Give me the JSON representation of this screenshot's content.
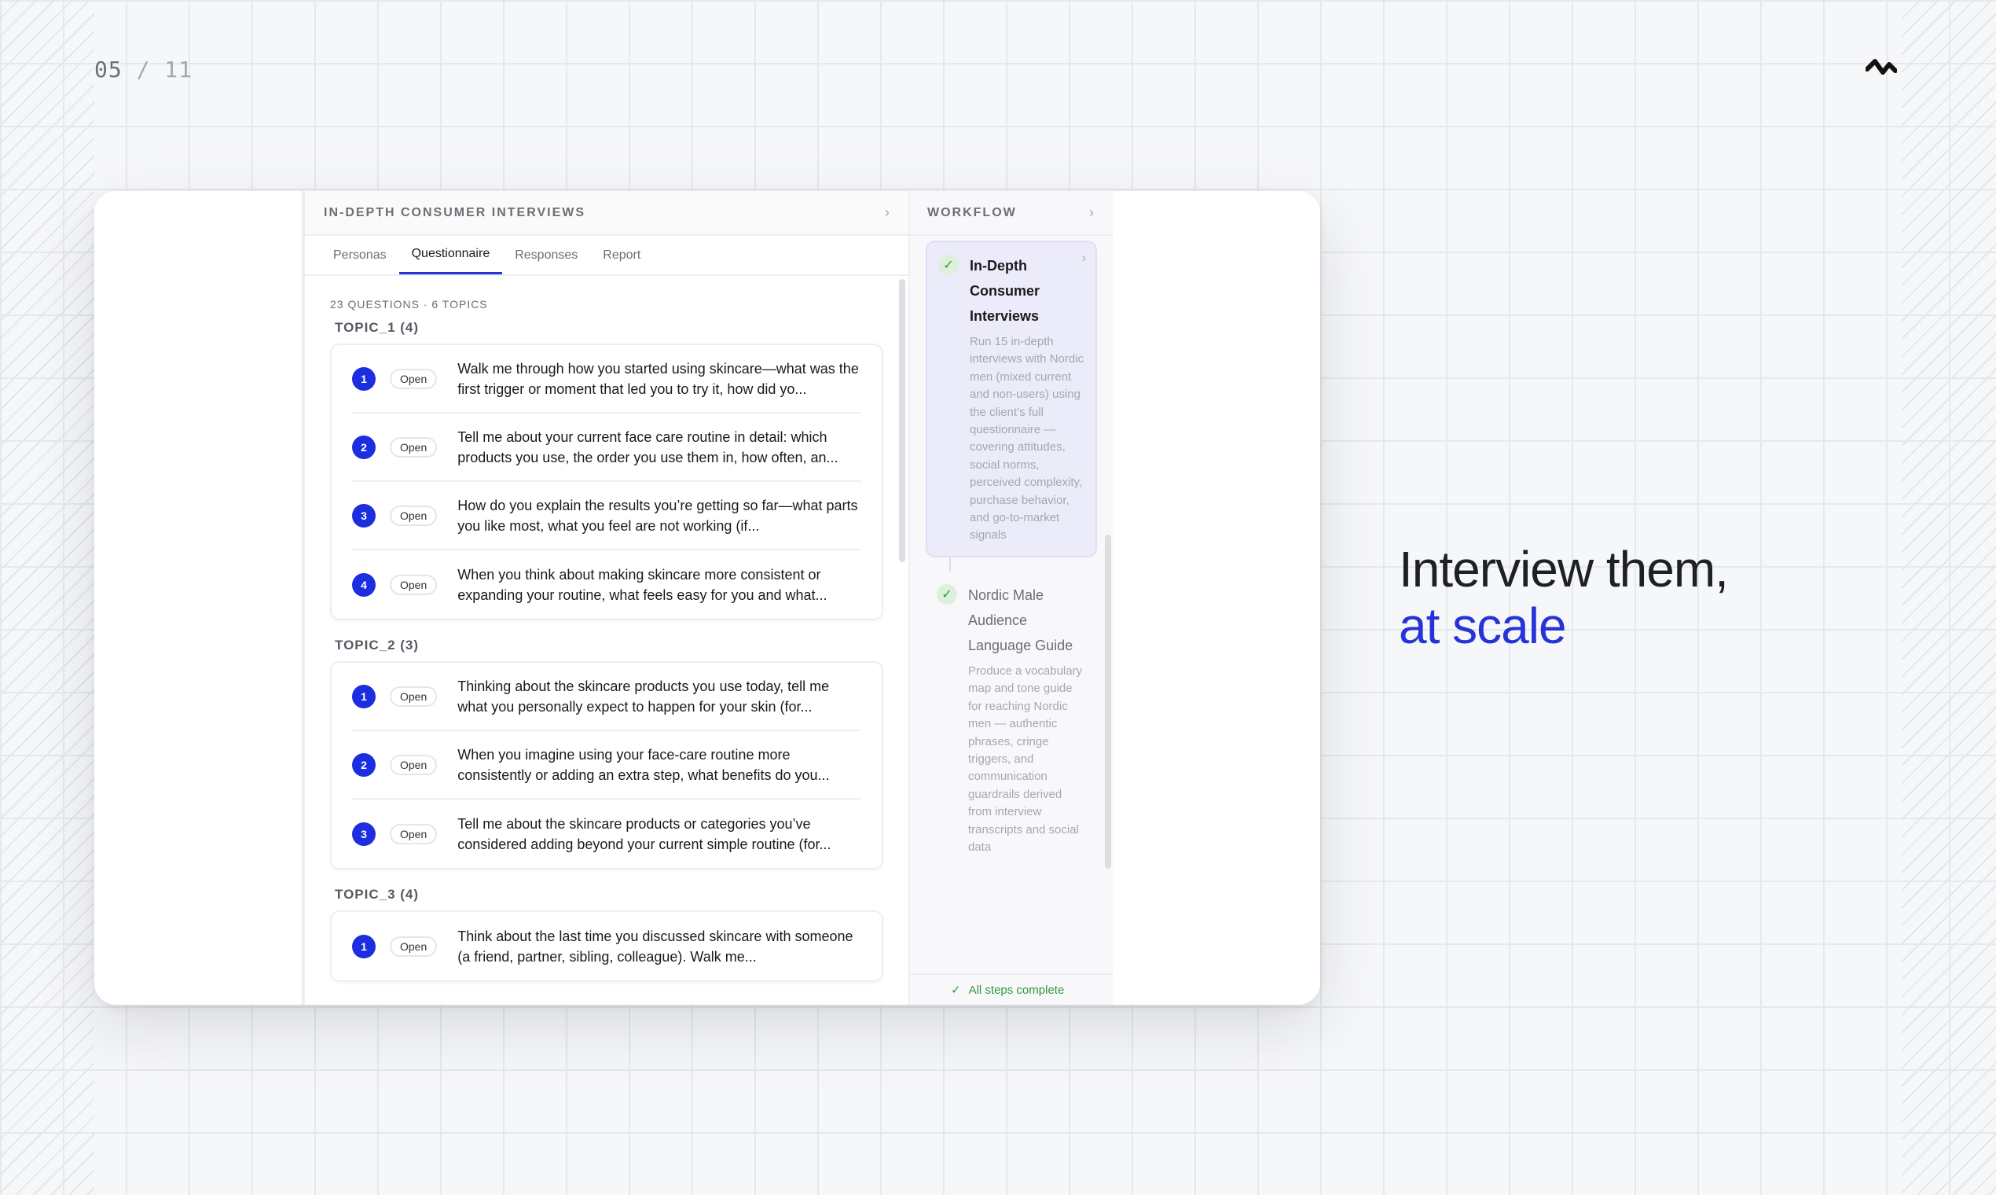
{
  "page": {
    "current": "05",
    "separator": " / ",
    "total": "11"
  },
  "colors": {
    "accent": "#2733d6",
    "number_badge": "#1c2ee0",
    "success": "#2e9a3e"
  },
  "main": {
    "title": "IN-DEPTH CONSUMER INTERVIEWS",
    "tabs": [
      {
        "label": "Personas"
      },
      {
        "label": "Questionnaire",
        "active": true
      },
      {
        "label": "Responses"
      },
      {
        "label": "Report"
      }
    ],
    "summary": "23 QUESTIONS · 6 TOPICS",
    "topics": [
      {
        "label": "TOPIC_1 (4)",
        "questions": [
          {
            "num": "1",
            "type": "Open",
            "text": "Walk me through how you started using skincare—what was the first trigger or moment that led you to try it, how did yo..."
          },
          {
            "num": "2",
            "type": "Open",
            "text": "Tell me about your current face care routine in detail: which products you use, the order you use them in, how often, an..."
          },
          {
            "num": "3",
            "type": "Open",
            "text": "How do you explain the results you’re getting so far—what parts you like most, what you feel are not working (if..."
          },
          {
            "num": "4",
            "type": "Open",
            "text": "When you think about making skincare more consistent or expanding your routine, what feels easy for you and what..."
          }
        ]
      },
      {
        "label": "TOPIC_2 (3)",
        "questions": [
          {
            "num": "1",
            "type": "Open",
            "text": "Thinking about the skincare products you use today, tell me what you personally expect to happen for your skin (for..."
          },
          {
            "num": "2",
            "type": "Open",
            "text": "When you imagine using your face-care routine more consistently or adding an extra step, what benefits do you..."
          },
          {
            "num": "3",
            "type": "Open",
            "text": "Tell me about the skincare products or categories you’ve considered adding beyond your current simple routine (for..."
          }
        ]
      },
      {
        "label": "TOPIC_3 (4)",
        "questions": [
          {
            "num": "1",
            "type": "Open",
            "text": "Think about the last time you discussed skincare with someone (a friend, partner, sibling, colleague). Walk me..."
          }
        ]
      }
    ]
  },
  "workflow": {
    "title": "WORKFLOW",
    "steps": [
      {
        "title": "In-Depth Consumer Interviews",
        "description": "Run 15 in-depth interviews with Nordic men (mixed current and non-users) using the client’s full questionnaire — covering attitudes, social norms, perceived complexity, purchase behavior, and go-to-market signals"
      },
      {
        "title": "Nordic Male Audience Language Guide",
        "description": "Produce a vocabulary map and tone guide for reaching Nordic men — authentic phrases, cringe triggers, and communication guardrails derived from interview transcripts and social data"
      }
    ],
    "footer": "All steps complete"
  },
  "headline": {
    "line1": "Interview them,",
    "line2": "at scale"
  },
  "icons": {
    "chevron": "chevron-right-icon",
    "check": "check-icon",
    "logo": "brand-logo-icon"
  }
}
